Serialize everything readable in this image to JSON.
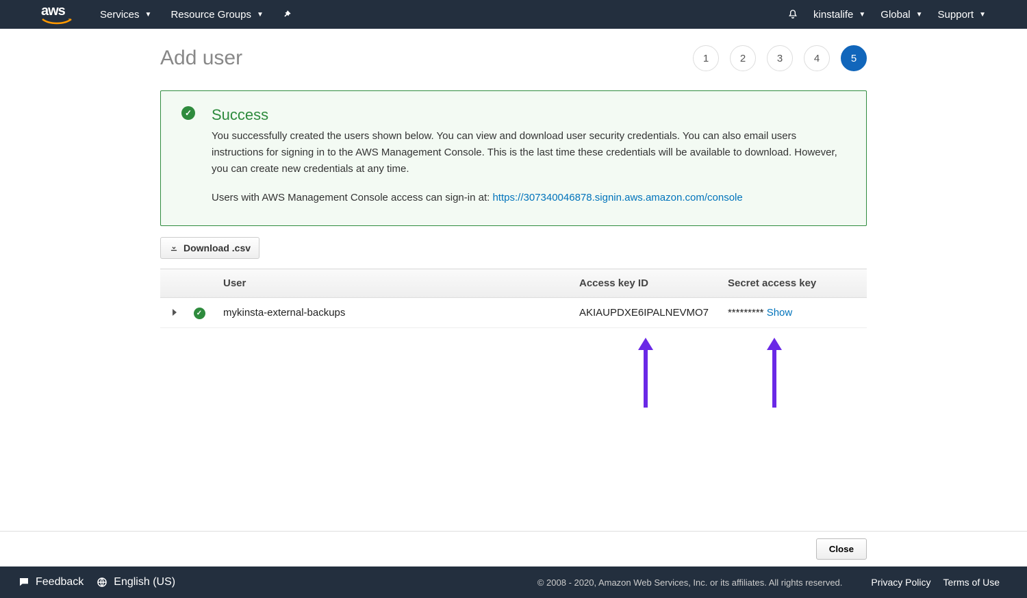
{
  "nav": {
    "logo_text": "aws",
    "services": "Services",
    "resource_groups": "Resource Groups",
    "account": "kinstalife",
    "region": "Global",
    "support": "Support"
  },
  "page": {
    "title": "Add user"
  },
  "steps": {
    "labels": [
      "1",
      "2",
      "3",
      "4",
      "5"
    ],
    "active_index": 4
  },
  "alert": {
    "title": "Success",
    "body1": "You successfully created the users shown below. You can view and download user security credentials. You can also email users instructions for signing in to the AWS Management Console. This is the last time these credentials will be available to download. However, you can create new credentials at any time.",
    "body2_prefix": "Users with AWS Management Console access can sign-in at: ",
    "body2_link": "https://307340046878.signin.aws.amazon.com/console"
  },
  "buttons": {
    "download_csv": "Download .csv",
    "close": "Close"
  },
  "table": {
    "headers": {
      "user": "User",
      "akid": "Access key ID",
      "secret": "Secret access key"
    },
    "rows": [
      {
        "user": "mykinsta-external-backups",
        "akid": "AKIAUPDXE6IPALNEVMO7",
        "secret_masked": "*********",
        "show": "Show"
      }
    ]
  },
  "footer": {
    "feedback": "Feedback",
    "language": "English (US)",
    "copyright": "© 2008 - 2020, Amazon Web Services, Inc. or its affiliates. All rights reserved.",
    "privacy": "Privacy Policy",
    "terms": "Terms of Use"
  }
}
